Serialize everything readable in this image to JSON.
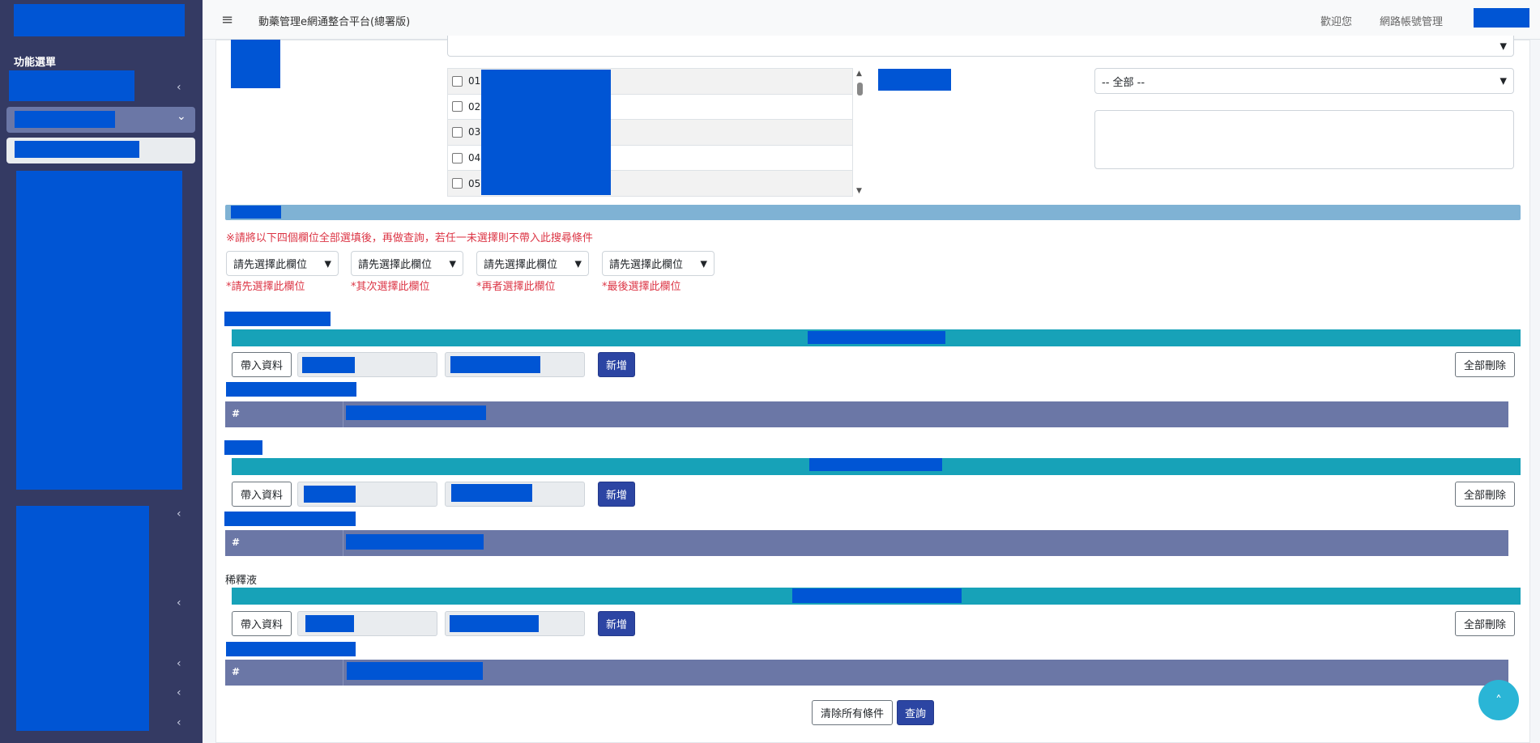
{
  "sidebar": {
    "menu_heading": "功能選單",
    "chevrons": {
      "left": "‹",
      "down": "⌄"
    }
  },
  "topnav": {
    "hamburger_icon": "≡",
    "title": "動藥管理e網通整合平台(總署版)",
    "welcome": "歡迎您",
    "account_mgmt": "網路帳號管理"
  },
  "filters": {
    "all_option": "-- 全部 --",
    "checkbox_items": [
      "01",
      "02",
      "03",
      "04",
      "05"
    ]
  },
  "notice": "※請將以下四個欄位全部選填後，再做查詢，若任一未選擇則不帶入此搜尋條件",
  "field_selects": [
    {
      "value": "請先選擇此欄位",
      "hint": "*請先選擇此欄位"
    },
    {
      "value": "請先選擇此欄位",
      "hint": "*其次選擇此欄位"
    },
    {
      "value": "請先選擇此欄位",
      "hint": "*再者選擇此欄位"
    },
    {
      "value": "請先選擇此欄位",
      "hint": "*最後選擇此欄位"
    }
  ],
  "sections": [
    {
      "label": "",
      "import_label": "帶入資料",
      "add_label": "新增",
      "delete_all_label": "全部刪除",
      "table_hash": "#"
    },
    {
      "label": "",
      "import_label": "帶入資料",
      "add_label": "新增",
      "delete_all_label": "全部刪除",
      "table_hash": "#"
    },
    {
      "label": "稀釋液",
      "import_label": "帶入資料",
      "add_label": "新增",
      "delete_all_label": "全部刪除",
      "table_hash": "#"
    }
  ],
  "actions": {
    "clear_label": "清除所有條件",
    "query_label": "查詢"
  },
  "scroll_top_icon": "˄",
  "colors": {
    "sidebar_bg": "#343a63",
    "redaction": "#0055d4",
    "teal_bar": "#17a2b8",
    "table_head": "#6b77a6",
    "primary_btn": "#2c45a3",
    "notice_red": "#dc3545"
  }
}
